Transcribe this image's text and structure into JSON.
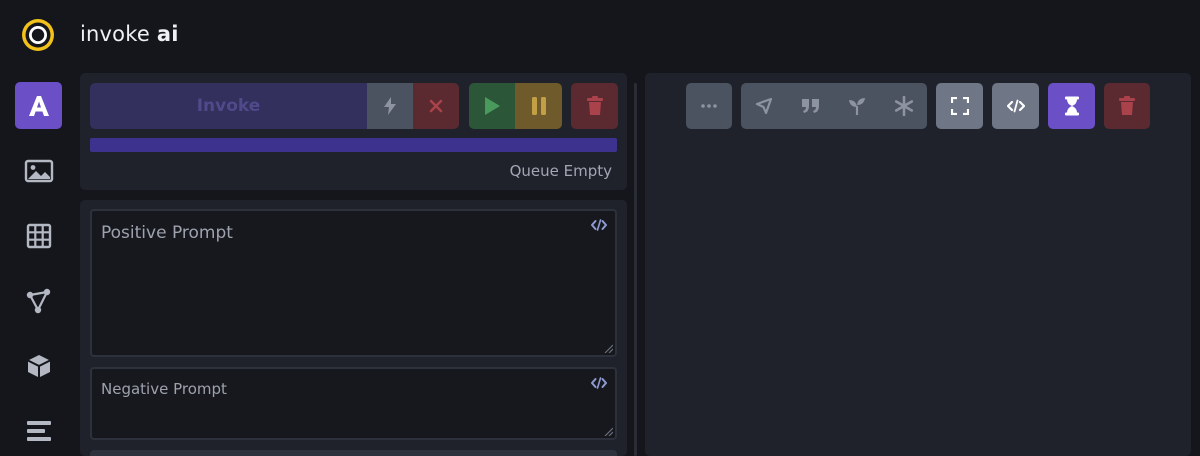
{
  "app": {
    "brand_light": "invoke",
    "brand_bold": "ai"
  },
  "sidebar": {
    "items": [
      {
        "icon": "text-to-image-icon",
        "active": true
      },
      {
        "icon": "image-icon",
        "active": false
      },
      {
        "icon": "grid-icon",
        "active": false
      },
      {
        "icon": "nodes-icon",
        "active": false
      },
      {
        "icon": "cube-icon",
        "active": false
      },
      {
        "icon": "list-icon",
        "active": false
      }
    ]
  },
  "queue": {
    "invoke_label": "Invoke",
    "status_text": "Queue Empty"
  },
  "prompts": {
    "positive_placeholder": "Positive Prompt",
    "negative_placeholder": "Negative Prompt"
  },
  "viewer_toolbar": {
    "buttons": [
      "more-icon",
      "share-icon",
      "quote-icon",
      "sprout-icon",
      "asterisk-icon",
      "fullscreen-icon",
      "code-icon",
      "hourglass-icon",
      "trash-icon"
    ]
  },
  "colors": {
    "accent": "#6a4fc7",
    "progress": "#3d338f",
    "logo_ring": "#f2c21a"
  }
}
